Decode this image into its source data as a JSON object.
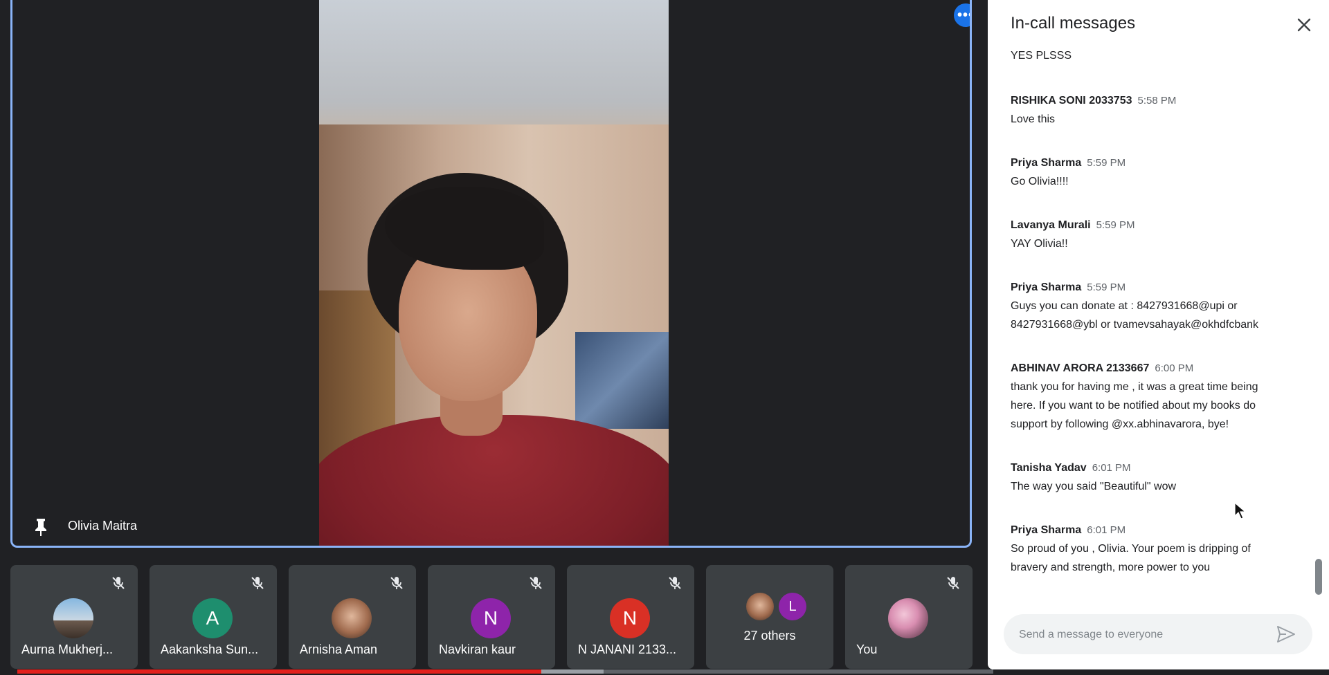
{
  "stage": {
    "speaker_name": "Olivia Maitra",
    "more_options_label": "•••"
  },
  "participants": [
    {
      "name": "Aurna Mukherj...",
      "avatar_type": "photo",
      "muted": true
    },
    {
      "name": "Aakanksha Sun...",
      "avatar_letter": "A",
      "avatar_color": "#1e8e6e",
      "muted": true
    },
    {
      "name": "Arnisha Aman",
      "avatar_type": "photo",
      "muted": true
    },
    {
      "name": "Navkiran kaur",
      "avatar_letter": "N",
      "avatar_color": "#8e24aa",
      "muted": true
    },
    {
      "name": "N JANANI 2133...",
      "avatar_letter": "N",
      "avatar_color": "#d93025",
      "muted": true
    },
    {
      "name": "27 others",
      "avatar_letter": "L",
      "avatar_color": "#8e24aa",
      "muted": false
    },
    {
      "name": "You",
      "avatar_type": "photo",
      "muted": true
    }
  ],
  "playback": {
    "played_fraction": 0.537,
    "buffered_fraction": 0.601
  },
  "chat": {
    "title": "In-call messages",
    "clipped_text": "YES PLSSS",
    "messages": [
      {
        "sender": "RISHIKA SONI 2033753",
        "time": "5:58 PM",
        "lines": [
          "Love this"
        ]
      },
      {
        "sender": "Priya Sharma",
        "time": "5:59 PM",
        "lines": [
          "Go Olivia!!!!"
        ]
      },
      {
        "sender": "Lavanya Murali",
        "time": "5:59 PM",
        "lines": [
          "YAY Olivia!!"
        ]
      },
      {
        "sender": "Priya Sharma",
        "time": "5:59 PM",
        "lines": [
          "Guys you can donate at : 8427931668@upi or",
          "8427931668@ybl or tvamevsahayak@okhdfcbank"
        ]
      },
      {
        "sender": "ABHINAV ARORA 2133667",
        "time": "6:00 PM",
        "lines": [
          "thank you for having me , it was a great time being",
          "here. If you want to be notified about my books do",
          "support by following @xx.abhinavarora, bye!"
        ]
      },
      {
        "sender": "Tanisha Yadav",
        "time": "6:01 PM",
        "lines": [
          "The way you said \"Beautiful\" wow"
        ]
      },
      {
        "sender": "Priya Sharma",
        "time": "6:01 PM",
        "lines": [
          "So proud of you , Olivia. Your poem is dripping of",
          "bravery and strength, more power to you"
        ]
      }
    ],
    "composer_placeholder": "Send a message to everyone"
  },
  "icons": {
    "pin": "pin-icon",
    "mic_off": "mic-off-icon",
    "close": "close-icon",
    "send": "send-icon",
    "more": "more-horiz-icon",
    "cursor": "mouse-cursor-icon"
  },
  "colors": {
    "accent": "#8ab4f8",
    "button_blue": "#1a73e8",
    "tile": "#3c4043",
    "progress_red": "#e2211c"
  }
}
